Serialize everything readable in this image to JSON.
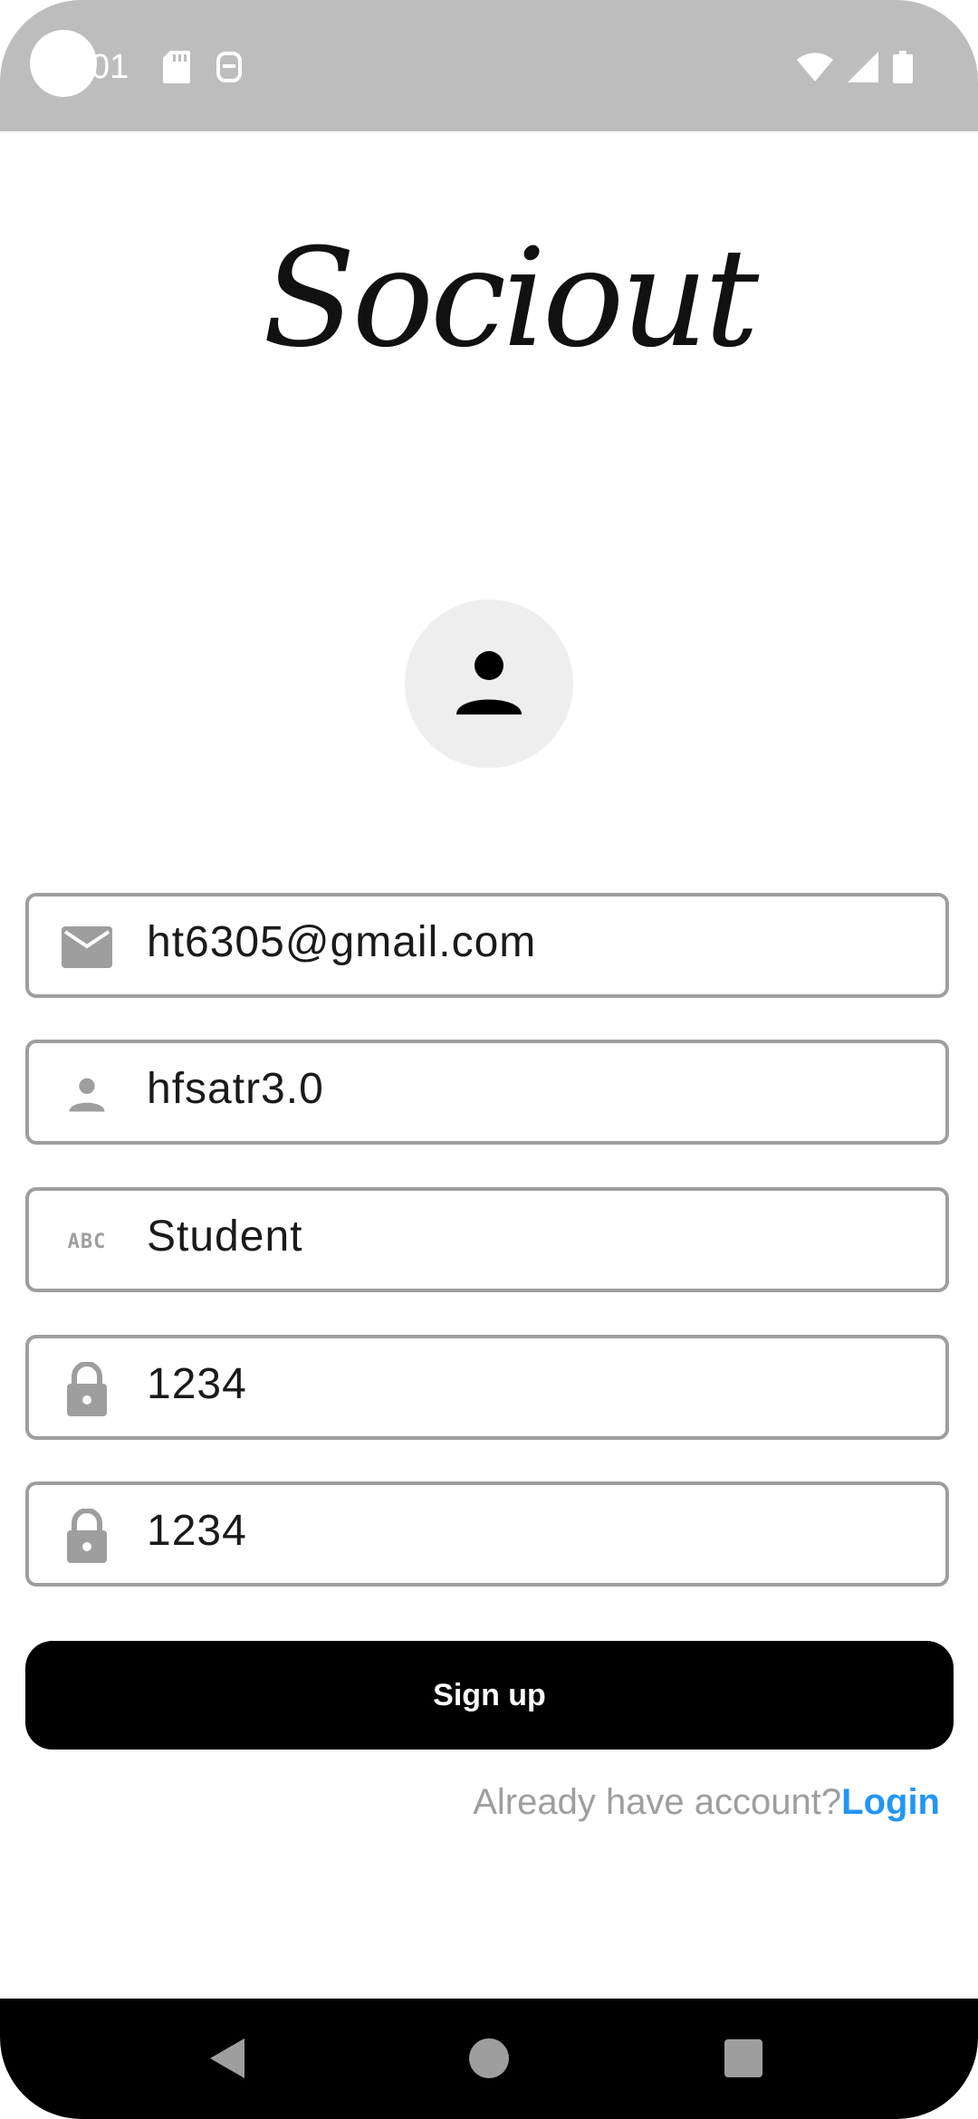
{
  "status_bar": {
    "time": "01",
    "left_icons": [
      "sd-card-icon",
      "android-debug-icon"
    ],
    "right_icons": [
      "wifi-icon",
      "cell-signal-icon",
      "battery-icon"
    ]
  },
  "logo": {
    "text": "Sociout"
  },
  "form": {
    "email": {
      "value": "ht6305@gmail.com",
      "icon": "mail-icon"
    },
    "username": {
      "value": "hfsatr3.0",
      "icon": "person-icon"
    },
    "role": {
      "value": "Student",
      "icon": "abc-icon",
      "icon_text": "ABC"
    },
    "password": {
      "value": "1234",
      "icon": "lock-icon"
    },
    "confirm_password": {
      "value": "1234",
      "icon": "lock-icon"
    }
  },
  "actions": {
    "signup_label": "Sign up",
    "login_prompt": "Already have account?",
    "login_link": "Login"
  },
  "colors": {
    "status_bar": "#bdbdbd",
    "field_border": "#9e9e9e",
    "primary_button": "#000000",
    "link": "#2196f3"
  }
}
